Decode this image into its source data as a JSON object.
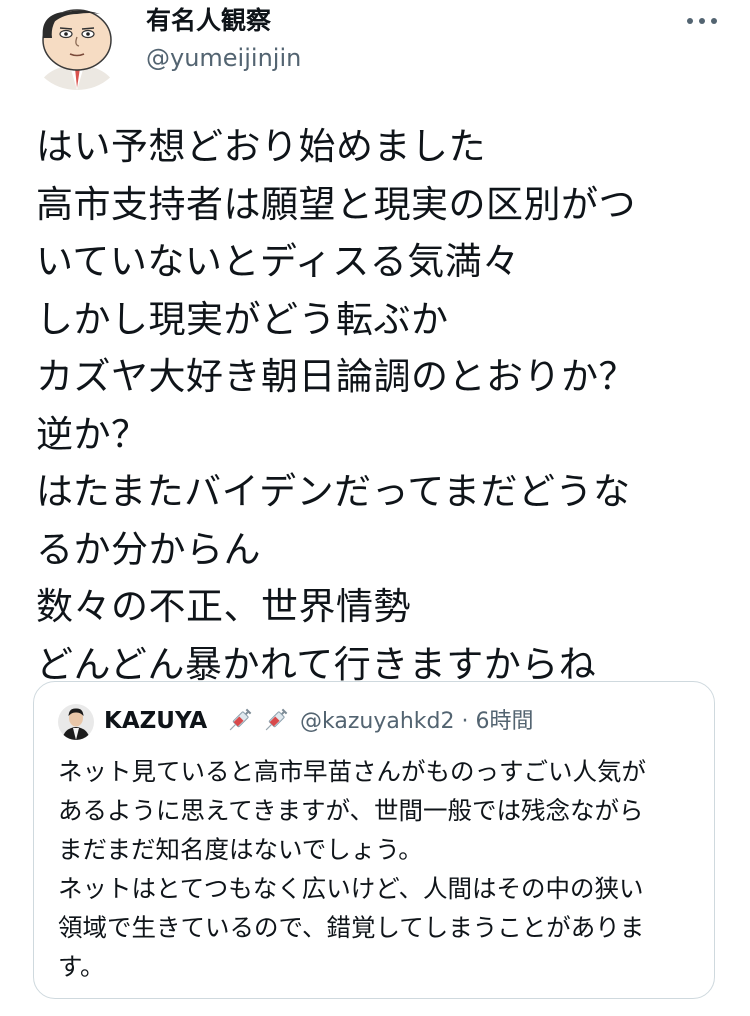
{
  "author": {
    "display_name": "有名人観察",
    "handle": "@yumeijinjin",
    "avatar": "cartoon-face-avatar"
  },
  "menu": {
    "icon": "more-horizontal-icon"
  },
  "tweet": {
    "lines": [
      "はい予想どおり始めました",
      "高市支持者は願望と現実の区別がつ",
      "いていないとディスる気満々",
      "しかし現実がどう転ぶか",
      "カズヤ大好き朝日論調のとおりか？",
      "逆か？",
      "はたまたバイデンだってまだどうな",
      "るか分からん",
      "数々の不正、世界情勢",
      "どんどん暴かれて行きますからね"
    ]
  },
  "quoted_tweet": {
    "display_name": "KAZUYA",
    "name_emojis": [
      "syringe-icon",
      "syringe-icon"
    ],
    "handle": "@kazuyahkd2",
    "separator": "·",
    "time": "6時間",
    "lines": [
      "ネット見ていると高市早苗さんがものっすごい人気が",
      "あるように思えてきますが、世間一般では残念ながら",
      "まだまだ知名度はないでしょう。",
      "ネットはとてつもなく広いけど、人間はその中の狭い",
      "領域で生きているので、錯覚してしまうことがありま",
      "す。"
    ]
  },
  "colors": {
    "text": "#0f1419",
    "secondary": "#536471",
    "border": "#cfd9de"
  }
}
